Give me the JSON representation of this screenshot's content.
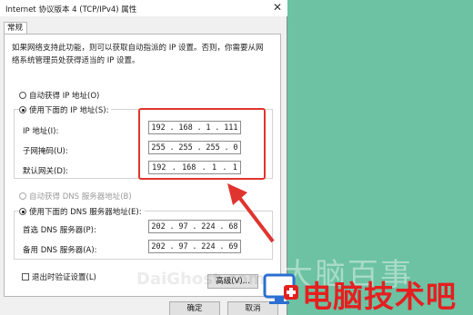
{
  "window": {
    "title": "Internet 协议版本 4 (TCP/IPv4) 属性",
    "close_glyph": "✕"
  },
  "tab": "常规",
  "description": "如果网络支持此功能，则可以获取自动指派的 IP 设置。否则，你需要从网络系统管理员处获得适当的 IP 设置。",
  "ip_section": {
    "auto_label": "自动获得 IP 地址(O)",
    "manual_label": "使用下面的 IP 地址(S):",
    "fields": [
      {
        "label": "IP 地址(I):",
        "octets": [
          "192",
          "168",
          "1",
          "111"
        ]
      },
      {
        "label": "子网掩码(U):",
        "octets": [
          "255",
          "255",
          "255",
          "0"
        ]
      },
      {
        "label": "默认网关(D):",
        "octets": [
          "192",
          "168",
          "1",
          "1"
        ]
      }
    ]
  },
  "dns_section": {
    "auto_label": "自动获得 DNS 服务器地址(B)",
    "manual_label": "使用下面的 DNS 服务器地址(E):",
    "fields": [
      {
        "label": "首选 DNS 服务器(P):",
        "octets": [
          "202",
          "97",
          "224",
          "68"
        ]
      },
      {
        "label": "备用 DNS 服务器(A):",
        "octets": [
          "202",
          "97",
          "224",
          "69"
        ]
      }
    ]
  },
  "validate_label": "退出时验证设置(L)",
  "buttons": {
    "advanced": "高级(V)...",
    "ok": "确定",
    "cancel": "取消"
  },
  "watermark": {
    "faint": "大脑百事",
    "brand": "电脑技术吧",
    "url": "DaiGhost.com"
  },
  "colors": {
    "background": "#6cc2a3",
    "highlight": "#e0342e",
    "brand": "#e51f20"
  }
}
